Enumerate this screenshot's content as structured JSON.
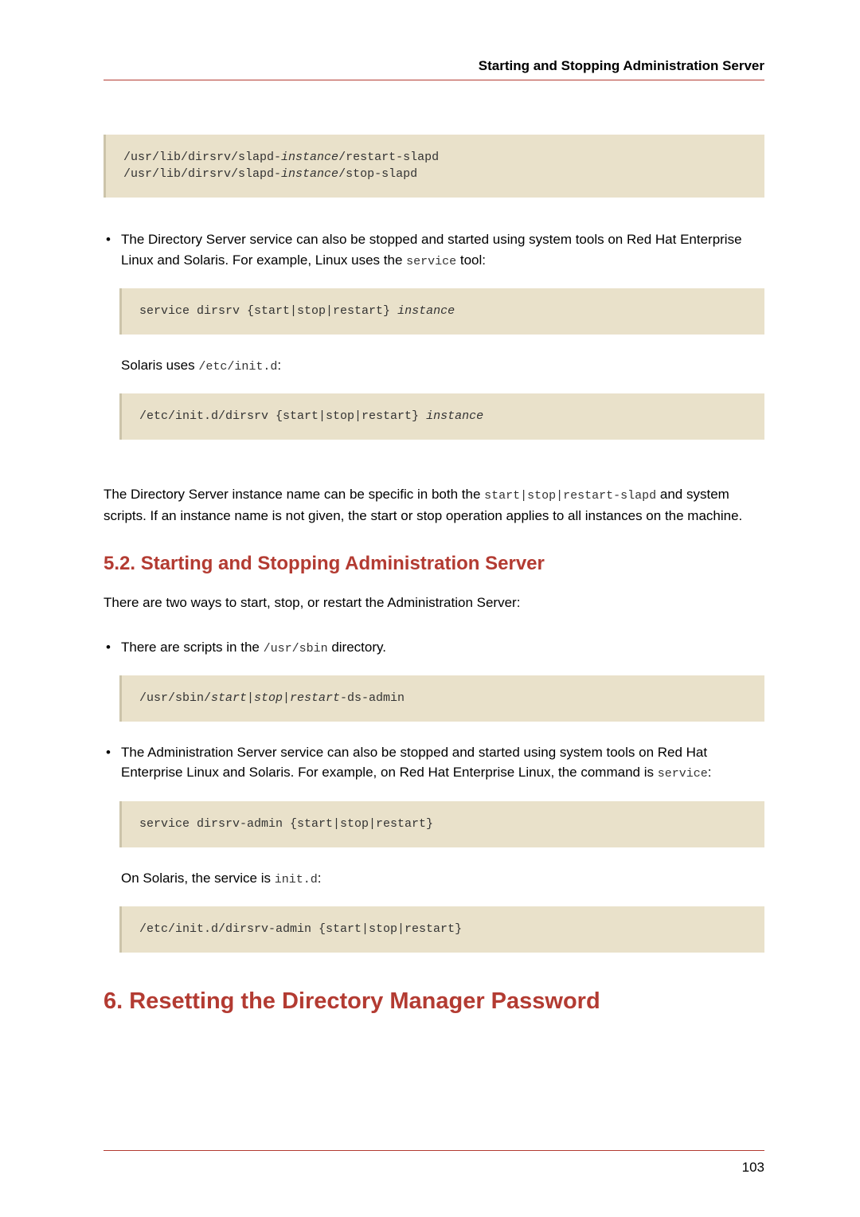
{
  "header": {
    "running_title": "Starting and Stopping Administration Server"
  },
  "code1_line1_a": "/usr/lib/dirsrv/slapd-",
  "code1_line1_b": "instance",
  "code1_line1_c": "/restart-slapd",
  "code1_line2_a": "/usr/lib/dirsrv/slapd-",
  "code1_line2_b": "instance",
  "code1_line2_c": "/stop-slapd",
  "bullet1_text_a": "The Directory Server service can also be stopped and started using system tools on Red Hat Enterprise Linux and Solaris. For example, Linux uses the ",
  "bullet1_code": "service",
  "bullet1_text_b": " tool:",
  "code2_a": "service dirsrv {start|stop|restart} ",
  "code2_b": "instance",
  "solaris_text_a": "Solaris uses ",
  "solaris_code": "/etc/init.d",
  "solaris_text_b": ":",
  "code3_a": "/etc/init.d/dirsrv {start|stop|restart} ",
  "code3_b": "instance",
  "para_after_a": "The Directory Server instance name can be specific in both the ",
  "para_after_code": "start|stop|restart-slapd",
  "para_after_b": " and system scripts. If an instance name is not given, the start or stop operation applies to all instances on the machine.",
  "section52_title": "5.2. Starting and Stopping Administration Server",
  "section52_intro": "There are two ways to start, stop, or restart the Administration Server:",
  "bullet2_text_a": "There are scripts in the ",
  "bullet2_code": "/usr/sbin",
  "bullet2_text_b": " directory.",
  "code4_a": "/usr/sbin/",
  "code4_b": "start|stop|restart",
  "code4_c": "-ds-admin",
  "bullet3_text_a": "The Administration Server service can also be stopped and started using system tools on Red Hat Enterprise Linux and Solaris. For example, on Red Hat Enterprise Linux, the command is ",
  "bullet3_code": "service",
  "bullet3_text_b": ":",
  "code5": "service dirsrv-admin {start|stop|restart}",
  "solaris2_text_a": "On Solaris, the service is ",
  "solaris2_code": "init.d",
  "solaris2_text_b": ":",
  "code6": "/etc/init.d/dirsrv-admin {start|stop|restart}",
  "chapter6_title": "6. Resetting the Directory Manager Password",
  "footer": {
    "page_number": "103"
  }
}
